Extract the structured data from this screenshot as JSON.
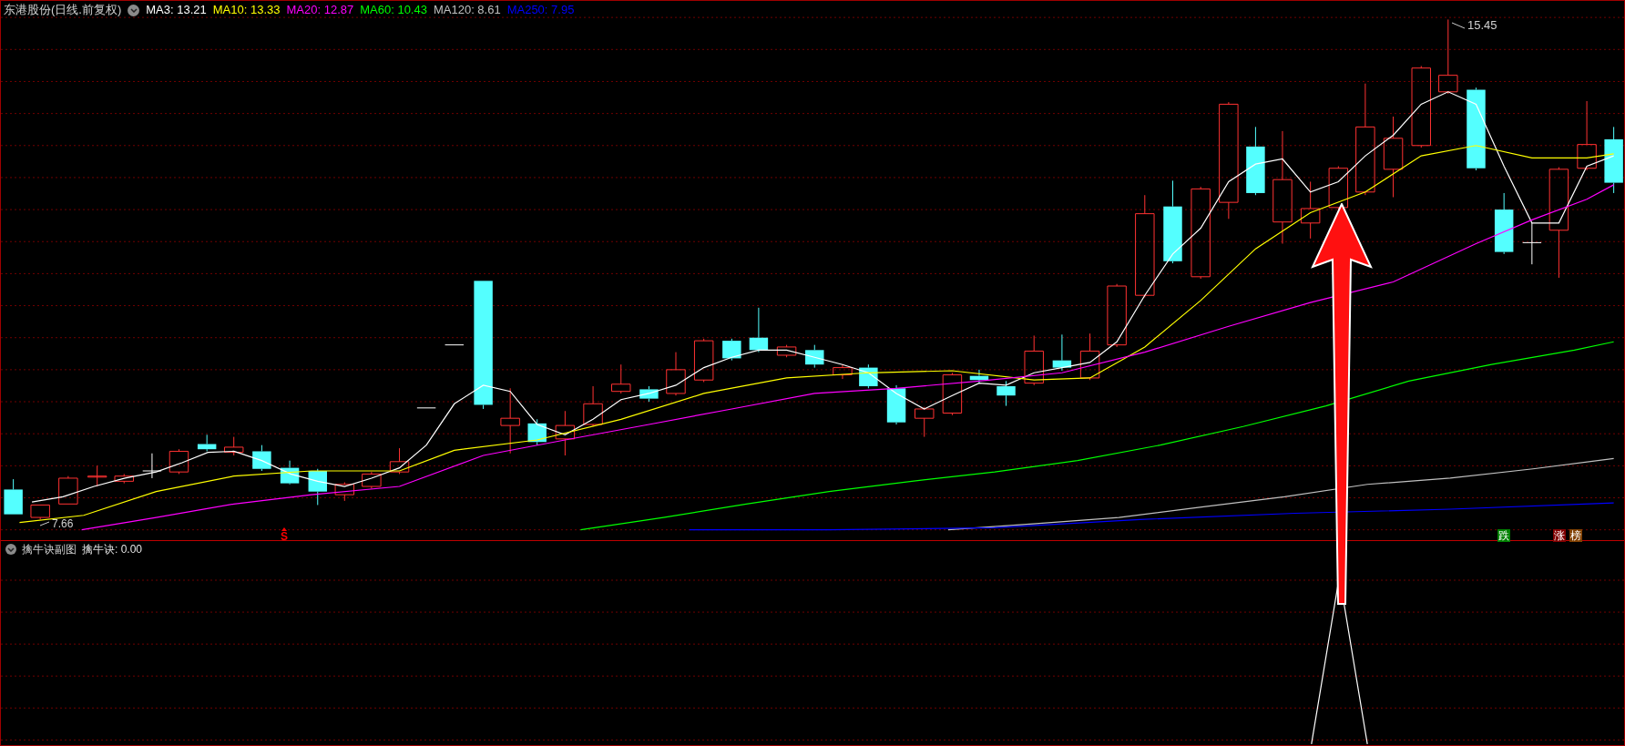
{
  "main_chart": {
    "title": "东港股份(日线.前复权)",
    "ma_legend": [
      {
        "label": "MA3: 13.21",
        "color": "#ffffff"
      },
      {
        "label": "MA10: 13.33",
        "color": "#ffff00"
      },
      {
        "label": "MA20: 12.87",
        "color": "#ff00ff"
      },
      {
        "label": "MA60: 10.43",
        "color": "#00ff00"
      },
      {
        "label": "MA120: 8.61",
        "color": "#c0c0c0"
      },
      {
        "label": "MA250: 7.95",
        "color": "#0000ff"
      }
    ],
    "high_label": "15.45",
    "low_label": "7.66",
    "markers": [
      {
        "kind": "signal",
        "text": "S",
        "color": "#ff0000"
      },
      {
        "kind": "badge",
        "text": "跌",
        "color": "#008000"
      },
      {
        "kind": "badge",
        "text": "涨",
        "color": "#800000"
      },
      {
        "kind": "badge",
        "text": "榜",
        "color": "#804000"
      }
    ]
  },
  "sub_chart": {
    "title": "擒牛诀副图",
    "indicator": "擒牛诀: 0.00"
  }
}
